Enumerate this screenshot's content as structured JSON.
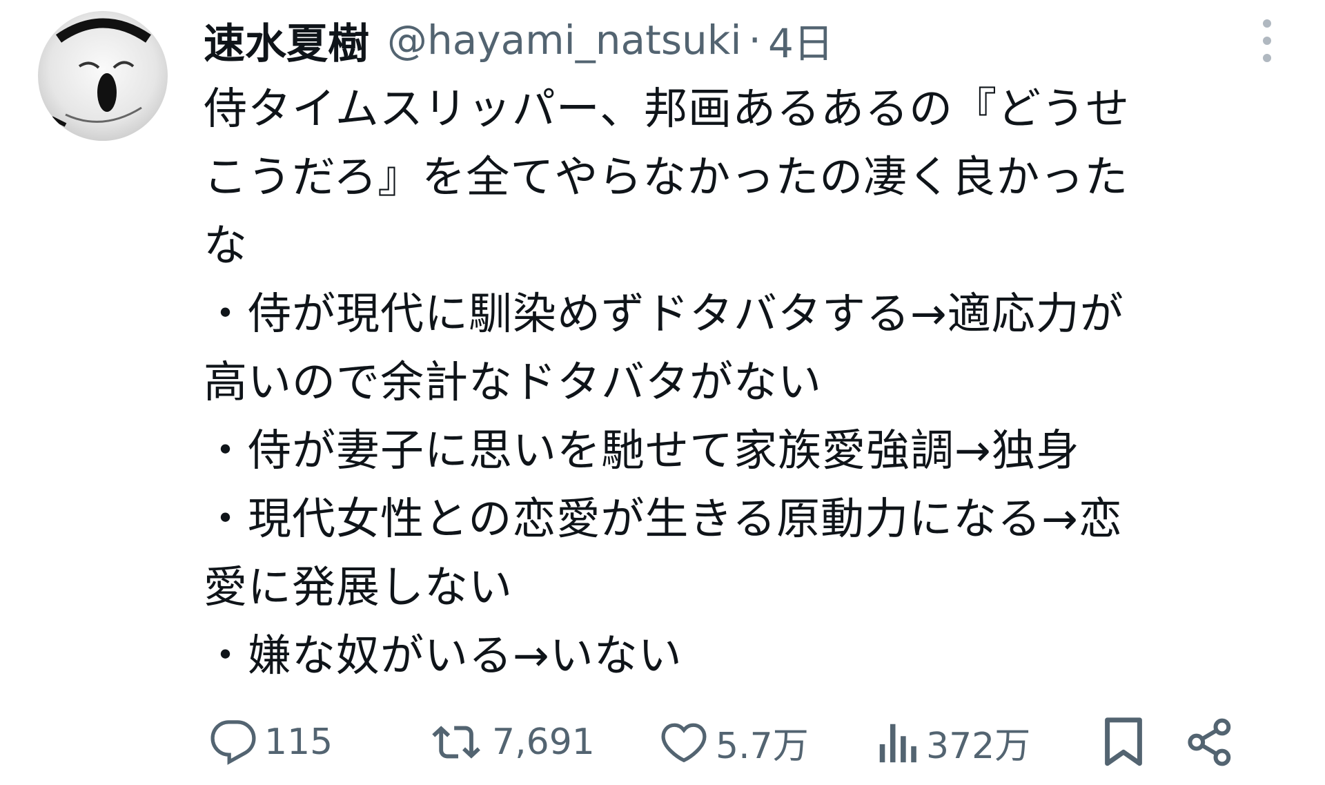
{
  "user": {
    "display_name": "速水夏樹",
    "handle": "@hayami_natsuki",
    "separator": "·",
    "time": "4日"
  },
  "tweet": {
    "lines": [
      "侍タイムスリッパー、邦画あるあるの『どうせ",
      "こうだろ』を全てやらなかったの凄く良かった",
      "な",
      "・侍が現代に馴染めずドタバタする→適応力が",
      "高いので余計なドタバタがない",
      "・侍が妻子に思いを馳せて家族愛強調→独身",
      "・現代女性との恋愛が生きる原動力になる→恋",
      "愛に発展しない",
      "・嫌な奴がいる→いない"
    ]
  },
  "actions": {
    "reply": {
      "icon": "reply-icon",
      "count": "115"
    },
    "retweet": {
      "icon": "retweet-icon",
      "count": "7,691"
    },
    "like": {
      "icon": "heart-icon",
      "count": "5.7万"
    },
    "views": {
      "icon": "views-icon",
      "count": "372万"
    },
    "bookmark": {
      "icon": "bookmark-icon"
    },
    "share": {
      "icon": "share-icon"
    }
  },
  "colors": {
    "text": "#0f1419",
    "secondary": "#536471"
  }
}
